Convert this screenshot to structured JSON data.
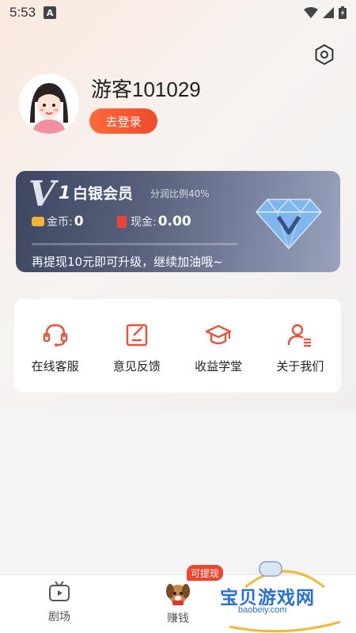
{
  "status_bar": {
    "time": "5:53",
    "app_icon_letter": "A"
  },
  "profile": {
    "username": "游客101029",
    "login_label": "去登录"
  },
  "vip": {
    "badge_v": "V",
    "level": "1",
    "name": "白银会员",
    "ratio": "分润比例40%",
    "coins_label": "金币:",
    "coins_value": "0",
    "cash_label": "现金:",
    "cash_value": "0.00",
    "progress": 0.0,
    "tip": "再提现10元即可升级，继续加油哦~"
  },
  "menu": {
    "items": [
      {
        "label": "在线客服",
        "icon": "headset-icon"
      },
      {
        "label": "意见反馈",
        "icon": "feedback-icon"
      },
      {
        "label": "收益学堂",
        "icon": "graduation-cap-icon"
      },
      {
        "label": "关于我们",
        "icon": "about-user-icon"
      }
    ]
  },
  "bottom_nav": {
    "items": [
      {
        "label": "剧场",
        "icon": "tv-icon"
      },
      {
        "label": "赚钱",
        "icon": "dog-icon"
      }
    ],
    "badge": "可提现"
  },
  "watermark": {
    "text": "宝贝游戏网",
    "url": "baobeiy.com"
  },
  "colors": {
    "accent": "#f04a2a",
    "vip_card": "#59617c",
    "menu_icon": "#e8523a"
  }
}
